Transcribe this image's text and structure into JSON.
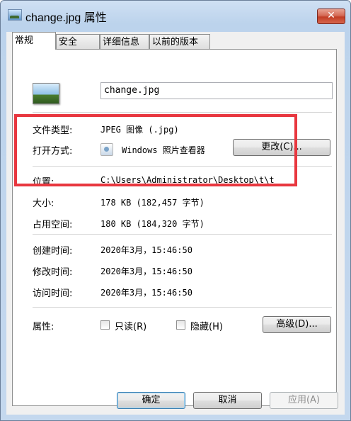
{
  "window": {
    "title": "change.jpg 属性",
    "close_label": "✕"
  },
  "tabs": [
    {
      "label": "常规"
    },
    {
      "label": "安全"
    },
    {
      "label": "详细信息"
    },
    {
      "label": "以前的版本"
    }
  ],
  "file": {
    "name": "change.jpg"
  },
  "info": {
    "type_label": "文件类型:",
    "type_value": "JPEG 图像 (.jpg)",
    "opens_label": "打开方式:",
    "opens_value": "Windows 照片查看器",
    "change_button": "更改(C)...",
    "location_label": "位置:",
    "location_value": "C:\\Users\\Administrator\\Desktop\\t\\t",
    "size_label": "大小:",
    "size_value": "178 KB (182,457 字节)",
    "disk_label": "占用空间:",
    "disk_value": "180 KB (184,320 字节)",
    "created_label": "创建时间:",
    "created_value": "2020年3月，15:46:50",
    "modified_label": "修改时间:",
    "modified_value": "2020年3月，15:46:50",
    "accessed_label": "访问时间:",
    "accessed_value": "2020年3月，15:46:50",
    "attributes_label": "属性:",
    "readonly_label": "只读(R)",
    "hidden_label": "隐藏(H)",
    "advanced_button": "高级(D)..."
  },
  "buttons": {
    "ok": "确定",
    "cancel": "取消",
    "apply": "应用(A)"
  },
  "colors": {
    "highlight": "#e8373f"
  }
}
